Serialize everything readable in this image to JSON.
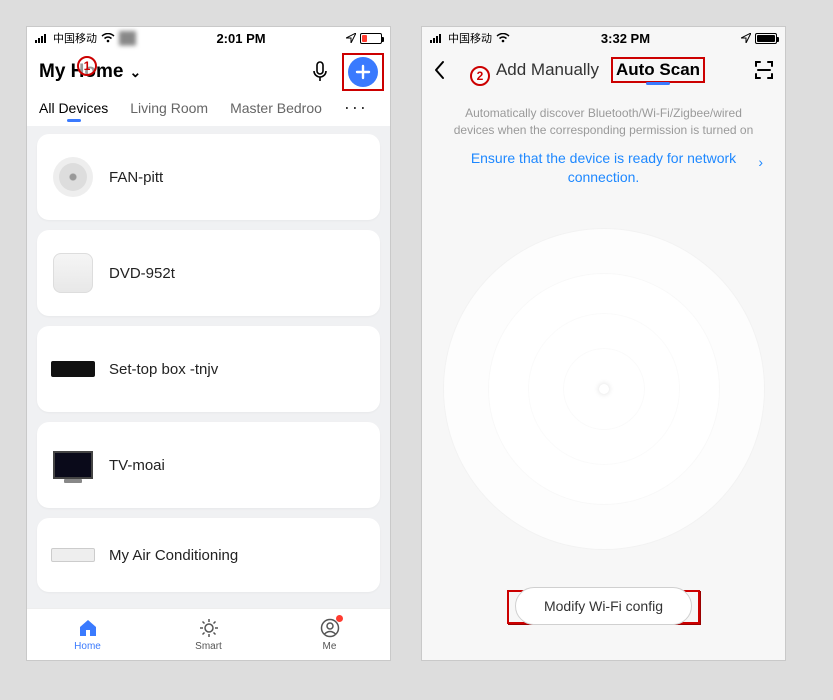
{
  "callouts": {
    "one": "1",
    "two": "2"
  },
  "phone1": {
    "status": {
      "carrier": "中国移动",
      "wifi_extra": "",
      "time": "2:01 PM"
    },
    "header": {
      "title": "My Home"
    },
    "tabs": {
      "all": "All Devices",
      "room1": "Living Room",
      "room2": "Master Bedroo",
      "more": "···"
    },
    "devices": [
      {
        "name": "FAN-pitt"
      },
      {
        "name": "DVD-952t"
      },
      {
        "name": "Set-top box -tnjv"
      },
      {
        "name": "TV-moai"
      },
      {
        "name": "My Air Conditioning"
      }
    ],
    "nav": {
      "home": "Home",
      "smart": "Smart",
      "me": "Me"
    }
  },
  "phone2": {
    "status": {
      "carrier": "中国移动",
      "time": "3:32 PM"
    },
    "header": {
      "tab_manual": "Add Manually",
      "tab_auto": "Auto Scan"
    },
    "desc": "Automatically discover Bluetooth/Wi-Fi/Zigbee/wired devices when the corresponding permission is turned on",
    "ready": "Ensure that the device is ready for network connection.",
    "modify": "Modify Wi-Fi config"
  }
}
